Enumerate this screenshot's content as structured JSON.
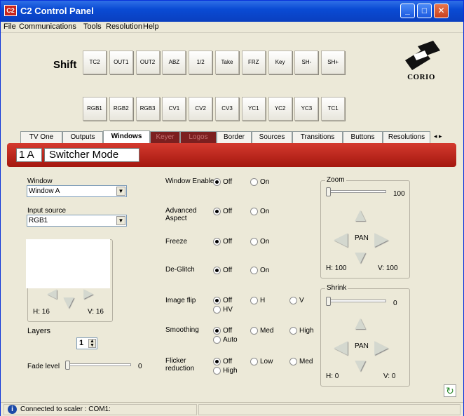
{
  "app": {
    "title": "C2 Control Panel",
    "icon_text": "C2"
  },
  "window_controls": {
    "minimize": "_",
    "maximize": "□",
    "close": "✕"
  },
  "menu": [
    {
      "label": "File"
    },
    {
      "label": "Communications"
    },
    {
      "label": "Tools"
    },
    {
      "label": "Resolution"
    },
    {
      "label": "Help"
    }
  ],
  "shift_label": "Shift",
  "buttons_row1": [
    "TC2",
    "OUT1",
    "OUT2",
    "ABZ",
    "1/2",
    "Take",
    "FRZ",
    "Key",
    "SH-",
    "SH+"
  ],
  "buttons_row2": [
    "RGB1",
    "RGB2",
    "RGB3",
    "CV1",
    "CV2",
    "CV3",
    "YC1",
    "YC2",
    "YC3",
    "TC1"
  ],
  "logo_text": "CORIO",
  "tabs": [
    "TV One",
    "Outputs",
    "Windows",
    "Keyer",
    "Logos",
    "Border",
    "Sources",
    "Transitions",
    "Buttons",
    "Resolutions"
  ],
  "active_tab": "Windows",
  "tab_scroll": "◂ ▸",
  "channel": "1 A",
  "mode": "Switcher Mode",
  "left": {
    "window_label": "Window",
    "window_value": "Window A",
    "input_label": "Input source",
    "input_value": "RGB1",
    "h_value": "H: 16",
    "v_value": "V: 16",
    "layers_label": "Layers",
    "layers_value": "1",
    "fade_label": "Fade level",
    "fade_value": "0"
  },
  "options": [
    {
      "label": "Window Enable",
      "choices": [
        "Off",
        "On"
      ],
      "selected": "Off"
    },
    {
      "label": "Advanced Aspect",
      "choices": [
        "Off",
        "On"
      ],
      "selected": "Off"
    },
    {
      "label": "Freeze",
      "choices": [
        "Off",
        "On"
      ],
      "selected": "Off"
    },
    {
      "label": "De-Glitch",
      "choices": [
        "Off",
        "On"
      ],
      "selected": "Off"
    },
    {
      "label": "Image flip",
      "choices": [
        "Off",
        "H",
        "V",
        "HV"
      ],
      "selected": "Off"
    },
    {
      "label": "Smoothing",
      "choices": [
        "Off",
        "Med",
        "High",
        "Auto"
      ],
      "selected": "Off"
    },
    {
      "label": "Flicker reduction",
      "choices": [
        "Off",
        "Low",
        "Med",
        "High"
      ],
      "selected": "Off"
    }
  ],
  "zoom": {
    "title": "Zoom",
    "value": "100",
    "pan": "PAN",
    "h": "H: 100",
    "v": "V: 100"
  },
  "shrink": {
    "title": "Shrink",
    "value": "0",
    "pan": "PAN",
    "h": "H: 0",
    "v": "V: 0"
  },
  "status": {
    "text": "Connected to scaler :  COM1:"
  }
}
